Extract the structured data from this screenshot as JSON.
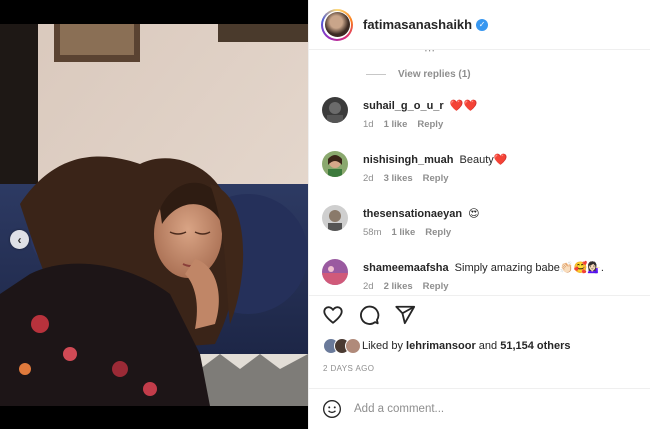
{
  "post": {
    "author": "fatimasanashaikh",
    "verified": true,
    "media_position": {
      "current": 1,
      "total": 2
    }
  },
  "comments": {
    "view_replies_label": "View replies (1)",
    "items": [
      {
        "user": "suhail_g_o_u_r",
        "text": "❤️❤️",
        "age": "1d",
        "likes": "1 like",
        "reply": "Reply"
      },
      {
        "user": "nishisingh_muah",
        "text": "Beauty❤️",
        "age": "2d",
        "likes": "3 likes",
        "reply": "Reply"
      },
      {
        "user": "thesensationaeyan",
        "text": "😍",
        "age": "58m",
        "likes": "1 like",
        "reply": "Reply"
      },
      {
        "user": "shameemaafsha",
        "text": "Simply amazing babe👏🏻🥰💁🏻‍♀️.",
        "age": "2d",
        "likes": "2 likes",
        "reply": "Reply"
      }
    ]
  },
  "likes": {
    "prefix": "Liked by",
    "first_liker": "lehrimansoor",
    "conjunction": "and",
    "others": "51,154 others"
  },
  "date": "2 DAYS AGO",
  "add_comment": {
    "placeholder": "Add a comment..."
  },
  "icons": {
    "like": "heart-icon",
    "comment": "comment-icon",
    "share": "share-icon",
    "emoji": "emoji-icon",
    "prev": "chevron-left-icon",
    "verified": "verified-badge-icon"
  },
  "colors": {
    "heart_red": "#ed4956",
    "link_blue": "#3897f0",
    "muted": "#8e8e8e",
    "text": "#262626"
  }
}
